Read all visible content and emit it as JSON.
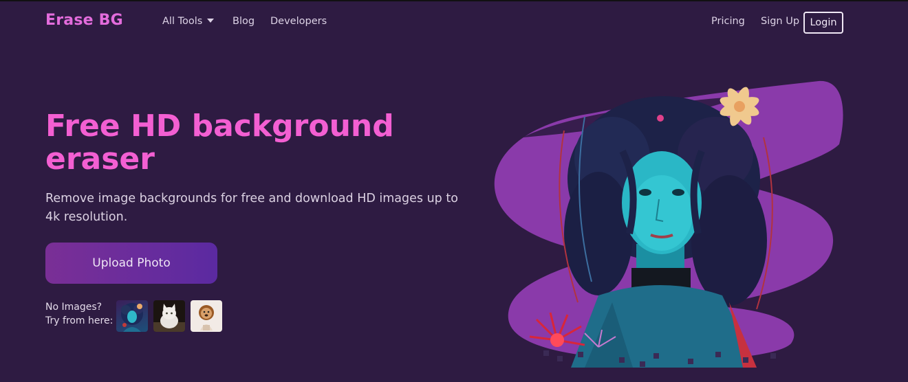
{
  "nav": {
    "brand": "Erase BG",
    "all_tools": "All Tools",
    "blog": "Blog",
    "developers": "Developers",
    "pricing": "Pricing",
    "sign_up": "Sign Up",
    "login": "Login"
  },
  "hero": {
    "title": "Free HD background eraser",
    "subtitle": "Remove image backgrounds for free and download HD images up to 4k resolution.",
    "upload_button": "Upload Photo",
    "samples_label_line1": "No Images?",
    "samples_label_line2": "Try from here:",
    "samples": [
      {
        "icon": "girl-portrait-thumbnail"
      },
      {
        "icon": "cat-thumbnail"
      },
      {
        "icon": "plush-toy-thumbnail"
      }
    ]
  },
  "colors": {
    "background": "#2e1b42",
    "brand": "#e36cdc",
    "headline": "#f35fd2",
    "accent_shape": "#8a3aaa",
    "button_gradient_start": "#7a2f96",
    "button_gradient_end": "#5b2aa1"
  }
}
